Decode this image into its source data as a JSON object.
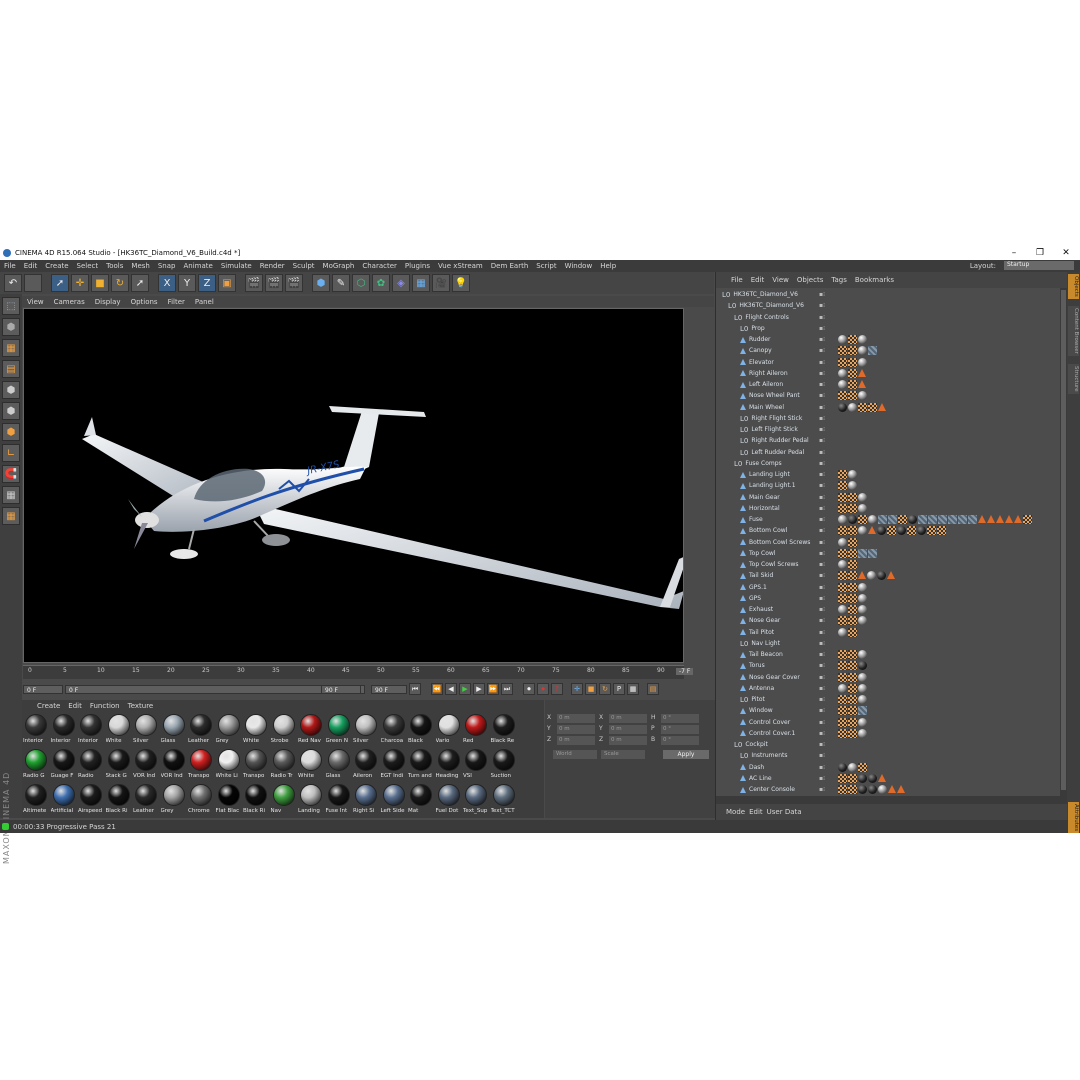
{
  "window": {
    "title": "CINEMA 4D R15.064 Studio - [HK36TC_Diamond_V6_Build.c4d *]",
    "minimize": "–",
    "maximize": "❐",
    "close": "✕"
  },
  "menubar": [
    "File",
    "Edit",
    "Create",
    "Select",
    "Tools",
    "Mesh",
    "Snap",
    "Animate",
    "Simulate",
    "Render",
    "Sculpt",
    "MoGraph",
    "Character",
    "Plugins",
    "Vue xStream",
    "Dem Earth",
    "Script",
    "Window",
    "Help"
  ],
  "layout": {
    "label": "Layout:",
    "value": "Startup"
  },
  "viewport_menu": [
    "View",
    "Cameras",
    "Display",
    "Options",
    "Filter",
    "Panel"
  ],
  "aircraft_registration": "JR-X7S",
  "timeline": {
    "ticks": [
      "0",
      "5",
      "10",
      "15",
      "20",
      "25",
      "30",
      "35",
      "40",
      "45",
      "50",
      "55",
      "60",
      "65",
      "70",
      "75",
      "80",
      "85",
      "90"
    ],
    "end_label": "-7 F"
  },
  "transport": {
    "current_frame": "0 F",
    "start_field": "0 F",
    "range_end": "90 F",
    "end_field": "90 F"
  },
  "material_menu": [
    "Create",
    "Edit",
    "Function",
    "Texture"
  ],
  "materials": [
    {
      "name": "Interior",
      "color": "#3a3a3a"
    },
    {
      "name": "Interior",
      "color": "#2a2a2a"
    },
    {
      "name": "Interior",
      "color": "#333333"
    },
    {
      "name": "White",
      "color": "#d8d8d8"
    },
    {
      "name": "Silver",
      "color": "#b0b0b0"
    },
    {
      "name": "Glass",
      "color": "#9aa7b2"
    },
    {
      "name": "Leather",
      "color": "#2c2c2c"
    },
    {
      "name": "Grey",
      "color": "#9a9a9a"
    },
    {
      "name": "White",
      "color": "#e8e8e8"
    },
    {
      "name": "Strobe",
      "color": "#cfcfcf"
    },
    {
      "name": "Red Nav",
      "color": "#b01818"
    },
    {
      "name": "Green N",
      "color": "#18a060"
    },
    {
      "name": "Silver",
      "color": "#c0c0c0"
    },
    {
      "name": "Charcoa",
      "color": "#3a3a3a"
    },
    {
      "name": "Black",
      "color": "#151515"
    },
    {
      "name": "Vario",
      "color": "#e0e0e0"
    },
    {
      "name": "Red",
      "color": "#c01a1a"
    },
    {
      "name": "Black Re",
      "color": "#1d1d1d"
    },
    {
      "name": "Radio G",
      "color": "#20a030"
    },
    {
      "name": "Guage F",
      "color": "#181818"
    },
    {
      "name": "Radio",
      "color": "#222222"
    },
    {
      "name": "Stack G",
      "color": "#1a1a1a"
    },
    {
      "name": "VOR Ind",
      "color": "#202020"
    },
    {
      "name": "VOR Ind",
      "color": "#111111"
    },
    {
      "name": "Transpo",
      "color": "#d02020"
    },
    {
      "name": "White Li",
      "color": "#f0f0f0"
    },
    {
      "name": "Transpo",
      "color": "#555555"
    },
    {
      "name": "Radio Tr",
      "color": "#5a5a5a"
    },
    {
      "name": "White",
      "color": "#dcdcdc"
    },
    {
      "name": "Glass",
      "color": "#6a6a6a"
    },
    {
      "name": "Aileron",
      "color": "#202020"
    },
    {
      "name": "EGT Indi",
      "color": "#1c1c1c"
    },
    {
      "name": "Turn and",
      "color": "#1a1a1a"
    },
    {
      "name": "Heading",
      "color": "#1e1e1e"
    },
    {
      "name": "VSI",
      "color": "#181818"
    },
    {
      "name": "Suction",
      "color": "#1a1a1a"
    },
    {
      "name": "Altimete",
      "color": "#202020"
    },
    {
      "name": "Artificial",
      "color": "#3f6fb0"
    },
    {
      "name": "Airspeed",
      "color": "#1b1b1b"
    },
    {
      "name": "Black Ri",
      "color": "#141414"
    },
    {
      "name": "Leather",
      "color": "#2a2a2a"
    },
    {
      "name": "Grey",
      "color": "#a4a4a4"
    },
    {
      "name": "Chrome",
      "color": "#707070"
    },
    {
      "name": "Flat Blac",
      "color": "#050505"
    },
    {
      "name": "Black Ri",
      "color": "#101010"
    },
    {
      "name": "Nav",
      "color": "#40a040"
    },
    {
      "name": "Landing",
      "color": "#bfbfbf"
    },
    {
      "name": "Fuse Int",
      "color": "#181818"
    },
    {
      "name": "Right Si",
      "color": "#5a7090"
    },
    {
      "name": "Left Side",
      "color": "#5a7090"
    },
    {
      "name": "Mat",
      "color": "#1a1a1a"
    },
    {
      "name": "Fuel Dot",
      "color": "#5a6a80"
    },
    {
      "name": "Text_Sup",
      "color": "#5a6a80"
    },
    {
      "name": "Text_TCT",
      "color": "#607080"
    }
  ],
  "coordinates": {
    "rows": [
      {
        "a": "X",
        "av": "0 m",
        "b": "X",
        "bv": "0 m",
        "c": "H",
        "cv": "0 °"
      },
      {
        "a": "Y",
        "av": "0 m",
        "b": "Y",
        "bv": "0 m",
        "c": "P",
        "cv": "0 °"
      },
      {
        "a": "Z",
        "av": "0 m",
        "b": "Z",
        "bv": "0 m",
        "c": "B",
        "cv": "0 °"
      }
    ],
    "mode1": "World",
    "mode2": "Scale",
    "apply": "Apply"
  },
  "status": "00:00:33 Progressive Pass 21",
  "object_menu": [
    "File",
    "Edit",
    "View",
    "Objects",
    "Tags",
    "Bookmarks"
  ],
  "objects": [
    {
      "name": "HK36TC_Diamond_V6",
      "depth": 0,
      "icon": "null",
      "tags": []
    },
    {
      "name": "HK36TC_Diamond_V6",
      "depth": 1,
      "icon": "null",
      "tags": []
    },
    {
      "name": "Flight Controls",
      "depth": 2,
      "icon": "null",
      "tags": []
    },
    {
      "name": "Prop",
      "depth": 3,
      "icon": "null",
      "tags": []
    },
    {
      "name": "Rudder",
      "depth": 3,
      "icon": "poly",
      "tags": [
        "s1",
        "chk",
        "s1"
      ]
    },
    {
      "name": "Canopy",
      "depth": 3,
      "icon": "poly",
      "tags": [
        "chk",
        "chk",
        "s1",
        "tex"
      ]
    },
    {
      "name": "Elevator",
      "depth": 3,
      "icon": "poly",
      "tags": [
        "chk",
        "chk",
        "s1"
      ]
    },
    {
      "name": "Right Aileron",
      "depth": 3,
      "icon": "poly",
      "tags": [
        "s1",
        "chk",
        "tri"
      ]
    },
    {
      "name": "Left Aileron",
      "depth": 3,
      "icon": "poly",
      "tags": [
        "s1",
        "chk",
        "tri"
      ]
    },
    {
      "name": "Nose Wheel Pant",
      "depth": 3,
      "icon": "poly",
      "tags": [
        "chk",
        "chk",
        "s1"
      ]
    },
    {
      "name": "Main Wheel",
      "depth": 3,
      "icon": "poly",
      "tags": [
        "s2",
        "s1",
        "chk",
        "chk",
        "tri"
      ]
    },
    {
      "name": "Right Flight Stick",
      "depth": 3,
      "icon": "null",
      "tags": []
    },
    {
      "name": "Left Flight Stick",
      "depth": 3,
      "icon": "null",
      "tags": []
    },
    {
      "name": "Right Rudder Pedal",
      "depth": 3,
      "icon": "null",
      "tags": []
    },
    {
      "name": "Left Rudder Pedal",
      "depth": 3,
      "icon": "null",
      "tags": []
    },
    {
      "name": "Fuse Comps",
      "depth": 2,
      "icon": "null",
      "tags": []
    },
    {
      "name": "Landing Light",
      "depth": 3,
      "icon": "poly",
      "tags": [
        "chk",
        "s1"
      ]
    },
    {
      "name": "Landing Light.1",
      "depth": 3,
      "icon": "poly",
      "tags": [
        "chk",
        "s1"
      ]
    },
    {
      "name": "Main Gear",
      "depth": 3,
      "icon": "poly",
      "tags": [
        "chk",
        "chk",
        "s1"
      ]
    },
    {
      "name": "Horizontal",
      "depth": 3,
      "icon": "poly",
      "tags": [
        "chk",
        "chk",
        "s1"
      ]
    },
    {
      "name": "Fuse",
      "depth": 3,
      "icon": "poly",
      "tags": [
        "s1",
        "s2",
        "chk",
        "s1",
        "tex",
        "tex",
        "chk",
        "s2",
        "tex",
        "tex",
        "tex",
        "tex",
        "tex",
        "tex",
        "tri",
        "tri",
        "tri",
        "tri",
        "tri",
        "chk"
      ]
    },
    {
      "name": "Bottom Cowl",
      "depth": 3,
      "icon": "poly",
      "tags": [
        "chk",
        "chk",
        "s1",
        "tri",
        "s2",
        "chk",
        "s2",
        "chk",
        "s2",
        "chk",
        "chk"
      ]
    },
    {
      "name": "Bottom Cowl Screws",
      "depth": 3,
      "icon": "poly",
      "tags": [
        "s1",
        "chk"
      ]
    },
    {
      "name": "Top Cowl",
      "depth": 3,
      "icon": "poly",
      "tags": [
        "chk",
        "chk",
        "tex",
        "tex"
      ]
    },
    {
      "name": "Top Cowl Screws",
      "depth": 3,
      "icon": "poly",
      "tags": [
        "s1",
        "chk"
      ]
    },
    {
      "name": "Tail Skid",
      "depth": 3,
      "icon": "poly",
      "tags": [
        "chk",
        "chk",
        "tri",
        "s1",
        "s2",
        "tri"
      ]
    },
    {
      "name": "GPS.1",
      "depth": 3,
      "icon": "poly",
      "tags": [
        "chk",
        "chk",
        "s1"
      ]
    },
    {
      "name": "GPS",
      "depth": 3,
      "icon": "poly",
      "tags": [
        "chk",
        "chk",
        "s1"
      ]
    },
    {
      "name": "Exhaust",
      "depth": 3,
      "icon": "poly",
      "tags": [
        "s1",
        "chk",
        "s1"
      ]
    },
    {
      "name": "Nose Gear",
      "depth": 3,
      "icon": "poly",
      "tags": [
        "chk",
        "chk",
        "s1"
      ]
    },
    {
      "name": "Tail Pitot",
      "depth": 3,
      "icon": "poly",
      "tags": [
        "s1",
        "chk"
      ]
    },
    {
      "name": "Nav Light",
      "depth": 3,
      "icon": "null",
      "tags": []
    },
    {
      "name": "Tail Beacon",
      "depth": 3,
      "icon": "poly",
      "tags": [
        "chk",
        "chk",
        "s1"
      ]
    },
    {
      "name": "Torus",
      "depth": 3,
      "icon": "poly",
      "tags": [
        "chk",
        "chk",
        "s2"
      ]
    },
    {
      "name": "Nose Gear Cover",
      "depth": 3,
      "icon": "poly",
      "tags": [
        "chk",
        "chk",
        "s1"
      ]
    },
    {
      "name": "Antenna",
      "depth": 3,
      "icon": "poly",
      "tags": [
        "s1",
        "chk",
        "s1"
      ]
    },
    {
      "name": "Pitot",
      "depth": 3,
      "icon": "null",
      "tags": [
        "chk",
        "chk",
        "s1"
      ]
    },
    {
      "name": "Window",
      "depth": 3,
      "icon": "poly",
      "tags": [
        "chk",
        "chk",
        "tex"
      ]
    },
    {
      "name": "Control Cover",
      "depth": 3,
      "icon": "poly",
      "tags": [
        "chk",
        "chk",
        "s1"
      ]
    },
    {
      "name": "Control Cover.1",
      "depth": 3,
      "icon": "poly",
      "tags": [
        "chk",
        "chk",
        "s1"
      ]
    },
    {
      "name": "Cockpit",
      "depth": 2,
      "icon": "null",
      "tags": []
    },
    {
      "name": "Instruments",
      "depth": 3,
      "icon": "null",
      "tags": []
    },
    {
      "name": "Dash",
      "depth": 3,
      "icon": "poly",
      "tags": [
        "s2",
        "s1",
        "chk"
      ]
    },
    {
      "name": "AC Line",
      "depth": 3,
      "icon": "poly",
      "tags": [
        "chk",
        "chk",
        "s2",
        "s2",
        "tri"
      ]
    },
    {
      "name": "Center Console",
      "depth": 3,
      "icon": "poly",
      "tags": [
        "chk",
        "chk",
        "s2",
        "s2",
        "s1",
        "tri",
        "tri"
      ]
    }
  ],
  "attr_menu": [
    "Mode",
    "Edit",
    "User Data"
  ],
  "right_tabs": [
    "Objects",
    "Content Browser",
    "Structure",
    "Attributes"
  ]
}
